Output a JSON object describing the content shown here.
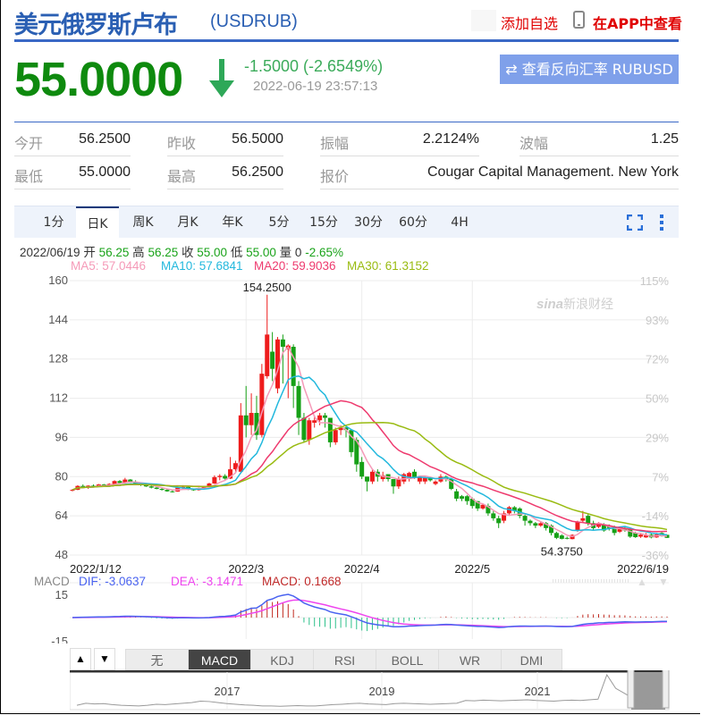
{
  "header": {
    "title": "美元俄罗斯卢布",
    "code": "(USDRUB)",
    "add_watchlist": "添加自选",
    "view_in_app": "在APP中查看"
  },
  "quote": {
    "price": "55.0000",
    "direction": "down",
    "change": "-1.5000 (-2.6549%)",
    "time": "2022-06-19 23:57:13",
    "reverse_button": "查看反向汇率 RUBUSD"
  },
  "stats": [
    {
      "label": "今开",
      "value": "56.2500"
    },
    {
      "label": "昨收",
      "value": "56.5000"
    },
    {
      "label": "振幅",
      "value": "2.2124%"
    },
    {
      "label": "波幅",
      "value": "1.25"
    },
    {
      "label": "最低",
      "value": "55.0000"
    },
    {
      "label": "最高",
      "value": "56.2500"
    },
    {
      "label": "报价",
      "value": "Cougar Capital Management. New York"
    }
  ],
  "tabs": [
    {
      "label": "1分"
    },
    {
      "label": "日K",
      "active": true
    },
    {
      "label": "周K"
    },
    {
      "label": "月K"
    },
    {
      "label": "年K"
    },
    {
      "label": "5分"
    },
    {
      "label": "15分"
    },
    {
      "label": "30分"
    },
    {
      "label": "60分"
    },
    {
      "label": "4H"
    }
  ],
  "toolbar_icons": [
    "fullscreen-icon",
    "more-vertical-icon"
  ],
  "info_line": {
    "date": "2022/06/19",
    "open_label": "开",
    "open": "56.25",
    "high_label": "高",
    "high": "56.25",
    "close_label": "收",
    "close": "55.00",
    "low_label": "低",
    "low": "55.00",
    "vol_label": "量",
    "vol": "0",
    "pct": "-2.65%"
  },
  "ma_legend": [
    {
      "text": "MA5: 57.0446",
      "color": "#f59ab8"
    },
    {
      "text": "MA10: 57.6841",
      "color": "#22b8dd"
    },
    {
      "text": "MA20: 59.9036",
      "color": "#ee3a6e"
    },
    {
      "text": "MA30: 61.3152",
      "color": "#99bb11"
    }
  ],
  "colors": {
    "up": "#ee1c1c",
    "down": "#16a016",
    "brand": "#2a5fb3",
    "price": "#0e8a0e",
    "dif": "#4a63f0",
    "dea": "#ee44ee"
  },
  "watermark": "新浪财经",
  "chart_data": {
    "type": "candlestick",
    "ylim": [
      48,
      160
    ],
    "y_ticks": [
      "160",
      "144",
      "128",
      "112",
      "96",
      "80",
      "64",
      "48"
    ],
    "y_ticks_right": [
      "115%",
      "93%",
      "72%",
      "50%",
      "29%",
      "7%",
      "-14%",
      "-36%"
    ],
    "x_ticks": [
      "2022/1/12",
      "2022/3",
      "2022/4",
      "2022/5",
      "2022/6/19"
    ],
    "max_label": "154.2500",
    "min_label": "54.3750",
    "grid": true,
    "ohlc": [
      [
        74.5,
        75,
        74,
        74.6
      ],
      [
        74.6,
        76.5,
        74.5,
        76.2
      ],
      [
        76.2,
        76.8,
        75.5,
        75.8
      ],
      [
        75.8,
        76.5,
        75,
        76.3
      ],
      [
        76.3,
        76.8,
        75.8,
        76
      ],
      [
        76,
        77,
        75.8,
        76.8
      ],
      [
        76.8,
        77,
        76,
        76.2
      ],
      [
        76.2,
        77.3,
        76,
        77
      ],
      [
        77,
        78.5,
        76.8,
        78.2
      ],
      [
        78.2,
        78.6,
        77.2,
        77.4
      ],
      [
        77.4,
        79.5,
        77.2,
        78.8
      ],
      [
        78.8,
        79,
        77.5,
        77.8
      ],
      [
        77.8,
        78.5,
        76.8,
        77
      ],
      [
        77,
        77.5,
        76.2,
        76.5
      ],
      [
        76.5,
        77,
        75.8,
        76
      ],
      [
        76,
        76.5,
        75.2,
        75.5
      ],
      [
        75.5,
        76,
        74.8,
        75
      ],
      [
        75,
        75.5,
        74.3,
        74.6
      ],
      [
        74.6,
        75,
        73.8,
        74
      ],
      [
        74,
        74.5,
        73.5,
        73.9
      ],
      [
        73.9,
        75.8,
        73.8,
        75.5
      ],
      [
        75.5,
        76.5,
        75,
        75.8
      ],
      [
        75.8,
        76,
        74.5,
        74.8
      ],
      [
        74.8,
        75.2,
        74.2,
        74.5
      ],
      [
        74.5,
        75.5,
        74.3,
        75.2
      ],
      [
        75.2,
        76,
        74.8,
        75.8
      ],
      [
        75.8,
        77.5,
        75.5,
        77.2
      ],
      [
        77.2,
        80.5,
        77,
        79.8
      ],
      [
        79.8,
        81,
        78.5,
        80.3
      ],
      [
        80.3,
        81,
        78.8,
        79.2
      ],
      [
        79.2,
        88,
        79,
        83
      ],
      [
        83,
        86.5,
        82,
        85.5
      ],
      [
        82,
        110,
        81.5,
        105
      ],
      [
        105,
        117,
        96,
        101
      ],
      [
        101,
        114,
        97,
        106
      ],
      [
        106,
        113,
        95,
        97
      ],
      [
        97,
        126,
        96,
        122
      ],
      [
        121,
        154.25,
        120,
        138
      ],
      [
        131,
        139,
        119,
        124
      ],
      [
        116,
        137,
        114,
        136
      ],
      [
        136,
        138,
        118,
        133
      ],
      [
        132,
        134,
        112,
        133.5
      ],
      [
        133,
        134,
        108,
        117
      ],
      [
        117,
        119,
        97,
        104
      ],
      [
        104,
        106,
        94,
        95
      ],
      [
        95,
        104,
        93,
        103
      ],
      [
        102,
        105,
        100,
        103
      ],
      [
        103,
        106,
        101,
        105
      ],
      [
        105,
        106,
        100,
        104
      ],
      [
        104,
        104,
        92,
        94
      ],
      [
        94,
        100,
        93,
        99
      ],
      [
        99,
        101,
        97,
        100
      ],
      [
        100,
        101,
        96,
        99
      ],
      [
        99,
        99,
        88,
        90
      ],
      [
        95,
        96,
        82,
        85
      ],
      [
        86,
        88,
        79,
        80
      ],
      [
        80,
        80,
        74,
        78
      ],
      [
        78,
        83,
        77,
        82
      ],
      [
        82,
        83,
        78,
        80
      ],
      [
        79,
        82,
        78,
        80.5
      ],
      [
        81,
        81,
        78,
        79
      ],
      [
        79,
        79,
        73,
        76
      ],
      [
        76,
        80,
        75,
        79
      ],
      [
        78,
        81.5,
        77,
        81
      ],
      [
        79,
        82,
        78,
        81.5
      ],
      [
        82,
        83,
        79,
        79.5
      ],
      [
        78,
        80,
        77,
        80
      ],
      [
        78,
        80,
        77,
        79.5
      ],
      [
        79.5,
        80,
        78,
        78.5
      ],
      [
        77,
        78.5,
        76.5,
        78
      ],
      [
        78,
        81,
        77.5,
        80
      ],
      [
        80,
        80.5,
        78,
        79
      ],
      [
        79,
        79.5,
        74.5,
        75
      ],
      [
        74,
        75,
        70,
        71
      ],
      [
        72,
        72.5,
        70,
        71
      ],
      [
        72,
        72.5,
        68.5,
        70
      ],
      [
        71,
        71.5,
        67,
        68
      ],
      [
        70,
        70,
        66,
        67
      ],
      [
        67,
        69,
        66.5,
        68.5
      ],
      [
        68,
        69,
        64,
        65
      ],
      [
        65,
        66,
        62,
        63
      ],
      [
        63,
        64,
        59,
        61
      ],
      [
        62,
        66,
        61,
        65
      ],
      [
        65,
        68,
        64,
        67.5
      ],
      [
        67.5,
        68,
        65,
        66
      ],
      [
        67,
        67.5,
        63,
        64
      ],
      [
        64,
        64.5,
        60,
        62
      ],
      [
        62,
        62.5,
        60,
        61
      ],
      [
        61,
        61.5,
        59,
        60
      ],
      [
        60,
        61.5,
        59.5,
        61
      ],
      [
        61,
        61.5,
        58,
        59
      ],
      [
        60,
        60.5,
        56,
        57
      ],
      [
        57,
        57.5,
        54.5,
        55
      ],
      [
        56,
        56.5,
        54.375,
        54.6
      ],
      [
        55,
        55.5,
        54.4,
        54.8
      ],
      [
        54.5,
        56.5,
        54.4,
        56.2
      ],
      [
        58,
        62,
        57.5,
        61.5
      ],
      [
        62,
        66,
        61.5,
        63
      ],
      [
        64,
        65,
        60,
        61
      ],
      [
        61,
        62,
        58,
        59
      ],
      [
        59.5,
        61.5,
        59,
        61
      ],
      [
        60.5,
        61,
        57.5,
        58
      ],
      [
        60,
        60.5,
        58,
        59
      ],
      [
        59.5,
        60,
        56,
        57
      ],
      [
        57.5,
        59.5,
        57,
        59
      ],
      [
        59,
        59.5,
        57.5,
        58
      ],
      [
        58.5,
        59,
        55,
        55.5
      ],
      [
        57,
        57.5,
        55,
        55.3
      ],
      [
        55.5,
        57,
        55,
        56.3
      ],
      [
        55.2,
        57,
        55,
        56
      ],
      [
        56.3,
        57,
        54.8,
        55.2
      ],
      [
        55.2,
        57,
        55,
        56.4
      ],
      [
        57,
        57.3,
        55.5,
        55.8
      ],
      [
        56.25,
        56.25,
        55,
        55
      ]
    ],
    "ma_periods": [
      5,
      10,
      20,
      30
    ]
  },
  "macd": {
    "label": "MACD",
    "dif": "DIF: -3.0637",
    "dea": "DEA: -3.1471",
    "macd": "MACD: 0.1668",
    "ylim": [
      -15,
      15
    ],
    "y_ticks": [
      "15",
      "-15"
    ]
  },
  "indicators": {
    "up": "▲",
    "down": "▼",
    "tabs": [
      {
        "label": "无"
      },
      {
        "label": "MACD",
        "active": true
      },
      {
        "label": "KDJ"
      },
      {
        "label": "RSI"
      },
      {
        "label": "BOLL"
      },
      {
        "label": "WR"
      },
      {
        "label": "DMI"
      }
    ]
  },
  "overview": {
    "years": [
      "2017",
      "2019",
      "2021"
    ],
    "values": [
      60,
      66,
      64,
      65,
      62,
      60,
      59,
      58,
      60,
      63,
      62,
      64,
      66,
      68,
      72,
      71,
      68,
      65,
      63,
      61,
      60,
      58,
      58,
      57,
      58,
      59,
      58,
      58,
      60,
      62,
      63,
      65,
      66,
      64,
      63,
      62,
      65,
      66,
      65,
      64,
      63,
      64,
      65,
      66,
      74,
      73,
      75,
      74,
      73,
      74,
      75,
      76,
      74,
      73,
      72,
      74,
      75,
      74,
      76,
      78,
      150,
      110,
      95,
      80,
      70,
      60,
      55
    ]
  }
}
